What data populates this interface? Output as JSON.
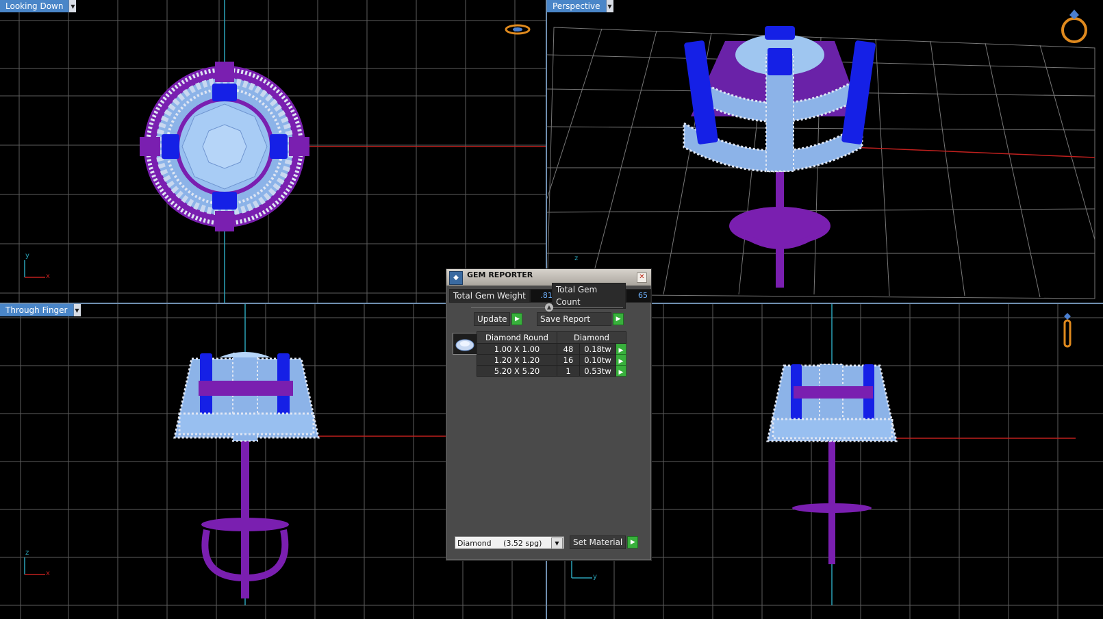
{
  "viewports": {
    "top_left": {
      "label": "Looking Down",
      "axis_v": "y",
      "axis_h": "x"
    },
    "top_right": {
      "label": "Perspective",
      "axis_v": "z"
    },
    "bottom_left": {
      "label": "Through Finger",
      "axis_v": "z",
      "axis_h": "x"
    },
    "bottom_right": {
      "axis_v": "z",
      "axis_h": "y"
    }
  },
  "icons": {
    "tab_dropdown": "chevron-down-icon",
    "ring_top": "ring-top-view-icon",
    "ring_perspective": "ring-perspective-icon",
    "ring_side": "ring-side-view-icon"
  },
  "gem_reporter": {
    "title": "GEM REPORTER",
    "total_weight_label": "Total Gem Weight",
    "total_weight_value": ".81",
    "total_count_label": "Total Gem Count",
    "total_count_value": "65",
    "update_label": "Update",
    "save_report_label": "Save Report",
    "table": {
      "headers": [
        "Diamond Round",
        "Diamond"
      ],
      "rows": [
        {
          "size": "1.00 X 1.00",
          "count": "48",
          "weight": "0.18tw"
        },
        {
          "size": "1.20 X 1.20",
          "count": "16",
          "weight": "0.10tw"
        },
        {
          "size": "5.20 X 5.20",
          "count": "1",
          "weight": "0.53tw"
        }
      ]
    },
    "material_value": "Diamond     (3.52 spg)",
    "set_material_label": "Set Material"
  },
  "colors": {
    "grid": "#6a6a6a",
    "axis_x": "#c0201e",
    "axis_y": "#2aa3b8",
    "metal": "#7a1fb0",
    "gem_light": "#9fc6f0",
    "gem_blue": "#1520e6",
    "tab_blue": "#4a86c8",
    "go_green": "#38b03c"
  }
}
